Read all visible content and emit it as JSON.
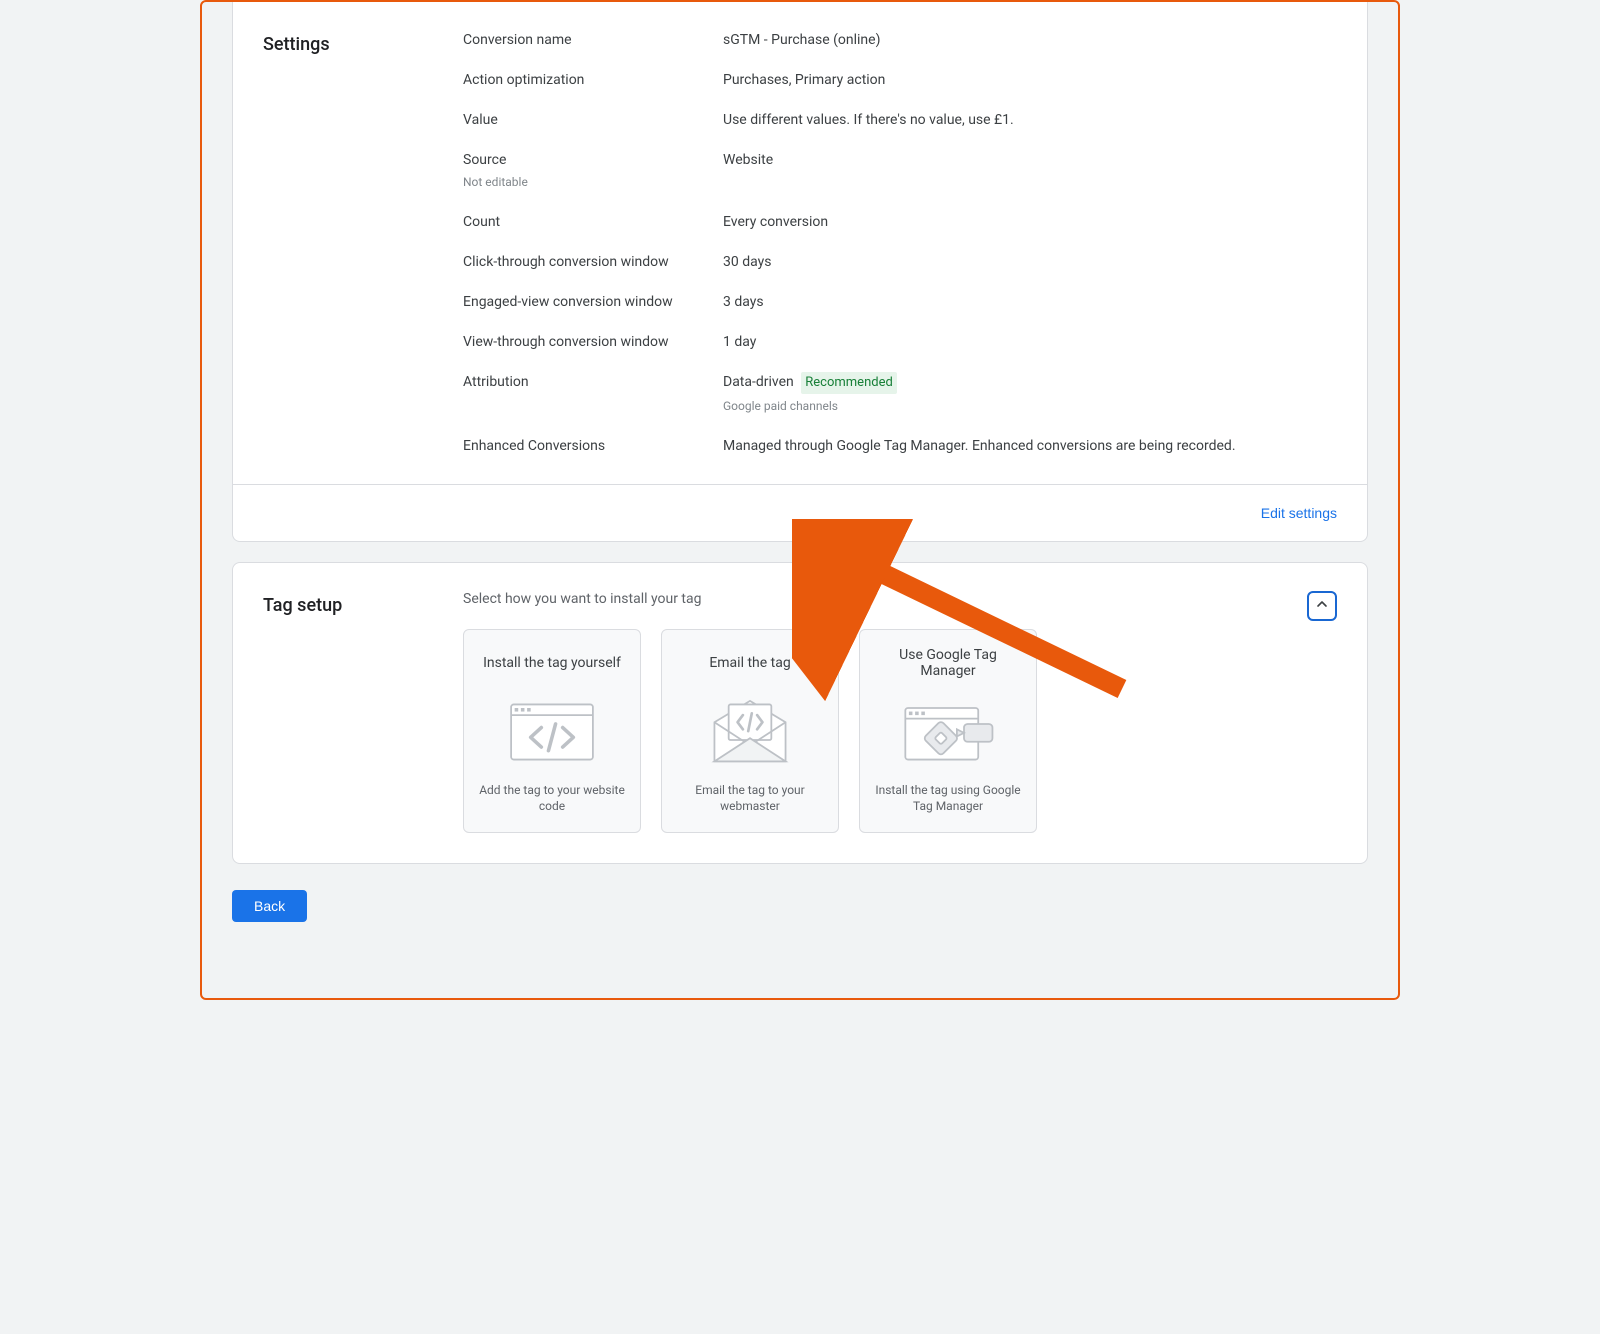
{
  "settings": {
    "title": "Settings",
    "rows": [
      {
        "label": "Conversion name",
        "value": "sGTM - Purchase (online)"
      },
      {
        "label": "Action optimization",
        "value": "Purchases, Primary action"
      },
      {
        "label": "Value",
        "value": "Use different values. If there's no value, use £1."
      },
      {
        "label": "Source",
        "label_sub": "Not editable",
        "value": "Website"
      },
      {
        "label": "Count",
        "value": "Every conversion"
      },
      {
        "label": "Click-through conversion window",
        "value": "30 days"
      },
      {
        "label": "Engaged-view conversion window",
        "value": "3 days"
      },
      {
        "label": "View-through conversion window",
        "value": "1 day"
      },
      {
        "label": "Attribution",
        "value": "Data-driven",
        "badge": "Recommended",
        "value_sub": "Google paid channels"
      },
      {
        "label": "Enhanced Conversions",
        "value": "Managed through Google Tag Manager. Enhanced conversions are being recorded."
      }
    ],
    "edit_label": "Edit settings"
  },
  "tag_setup": {
    "title": "Tag setup",
    "intro": "Select how you want to install your tag",
    "tiles": [
      {
        "title": "Install the tag yourself",
        "desc": "Add the tag to your website code"
      },
      {
        "title": "Email the tag",
        "desc": "Email the tag to your webmaster"
      },
      {
        "title": "Use Google Tag Manager",
        "desc": "Install the tag using Google Tag Manager"
      }
    ]
  },
  "footer": {
    "back_label": "Back"
  }
}
